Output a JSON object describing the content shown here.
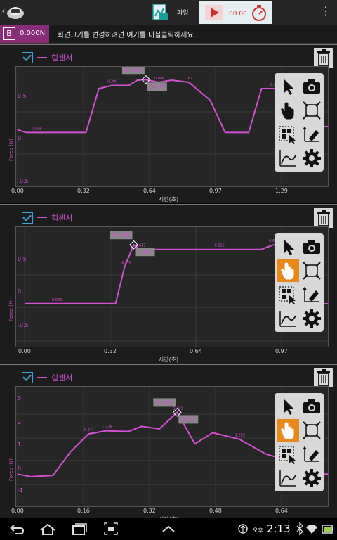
{
  "toolbar": {
    "file_label": "파일",
    "timer": "00.00"
  },
  "infobar": {
    "badge_letter": "B",
    "badge_value": "0.000N",
    "message": "화면크기를 변경하려면 여기를 더블클릭하세요..."
  },
  "panels": [
    {
      "legend": "힘센서",
      "ylabel": "Force (N)",
      "xlabel": "시간(초)",
      "yticks": [
        "0.5",
        "0",
        "-0.5"
      ],
      "xticks": [
        "0.00",
        "0.32",
        "0.64",
        "0.97",
        "1.29"
      ],
      "cursor_value": "0.445",
      "cursor_time": "0.60",
      "point_labels": [
        "-0.056",
        "0.390",
        "0.446",
        "-167",
        "0.3"
      ],
      "active_tool": "none"
    },
    {
      "legend": "힘센서",
      "ylabel": "Force (N)",
      "xlabel": "시간(초)",
      "yticks": [
        "0.5",
        "0",
        "-0.5"
      ],
      "xticks": [
        "0.00",
        "0.32",
        "0.64",
        "0.97"
      ],
      "cursor_value": "0.668",
      "cursor_time": "0.36",
      "point_labels": [
        "-0.056",
        "-0.3?6",
        "0.612",
        "0.612",
        "0.668",
        "-0.058"
      ],
      "active_tool": "hand"
    },
    {
      "legend": "힘센서",
      "ylabel": "Force (N)",
      "xlabel": "시간(초)",
      "yticks": [
        "3",
        "2",
        "1",
        "0",
        "-1"
      ],
      "xticks": [
        "0.00",
        "0.16",
        "0.32",
        "0.48",
        "0.64"
      ],
      "cursor_value": "2.461",
      "cursor_time": "0.36",
      "point_labels": [
        "0.9??",
        "1.726",
        "2.461",
        "1.392",
        "0.597"
      ],
      "active_tool": "hand"
    }
  ],
  "statusbar": {
    "ampm": "오후",
    "time": "2:13"
  },
  "colors": {
    "series": "#d44fd4",
    "badge": "#8a2d79",
    "active_tool": "#e8891b",
    "checkbox": "#3da3dd"
  },
  "chart_data": [
    {
      "type": "line",
      "x": [
        0.0,
        0.04,
        0.08,
        0.16,
        0.32,
        0.38,
        0.44,
        0.52,
        0.56,
        0.6,
        0.66,
        0.72,
        0.8,
        0.9,
        0.97,
        1.02,
        1.08,
        1.14,
        1.2,
        1.26,
        1.3,
        1.36,
        1.45
      ],
      "series": [
        {
          "values": [
            -0.03,
            -0.056,
            -0.056,
            -0.056,
            -0.056,
            0.36,
            0.39,
            0.39,
            0.44,
            0.445,
            0.42,
            0.44,
            0.42,
            0.25,
            -0.056,
            -0.056,
            -0.056,
            0.36,
            0.36,
            0.36,
            0.36,
            0.0,
            0.0
          ]
        }
      ],
      "ylim": [
        -0.5,
        0.5
      ],
      "xlim": [
        0.0,
        1.45
      ]
    },
    {
      "type": "line",
      "x": [
        0.0,
        0.1,
        0.2,
        0.3,
        0.33,
        0.36,
        0.38,
        0.5,
        0.64,
        0.78,
        0.82,
        0.86,
        0.9,
        0.95,
        1.0
      ],
      "series": [
        {
          "values": [
            -0.056,
            -0.056,
            -0.056,
            -0.056,
            0.4,
            0.668,
            0.612,
            0.612,
            0.612,
            0.612,
            0.668,
            0.668,
            0.4,
            -0.058,
            -0.058
          ]
        }
      ],
      "ylim": [
        -0.5,
        0.8
      ],
      "xlim": [
        0.0,
        1.0
      ]
    },
    {
      "type": "line",
      "x": [
        0.0,
        0.03,
        0.08,
        0.12,
        0.16,
        0.2,
        0.25,
        0.28,
        0.32,
        0.36,
        0.4,
        0.44,
        0.5,
        0.56,
        0.6,
        0.64,
        0.66,
        0.7
      ],
      "series": [
        {
          "values": [
            0.0,
            -0.1,
            -0.05,
            0.9,
            1.6,
            1.726,
            1.7,
            1.9,
            1.8,
            2.461,
            1.2,
            1.65,
            1.392,
            0.8,
            0.597,
            0.6,
            0.0,
            0.0
          ]
        }
      ],
      "ylim": [
        -1.0,
        3.2
      ],
      "xlim": [
        0.0,
        0.7
      ]
    }
  ]
}
